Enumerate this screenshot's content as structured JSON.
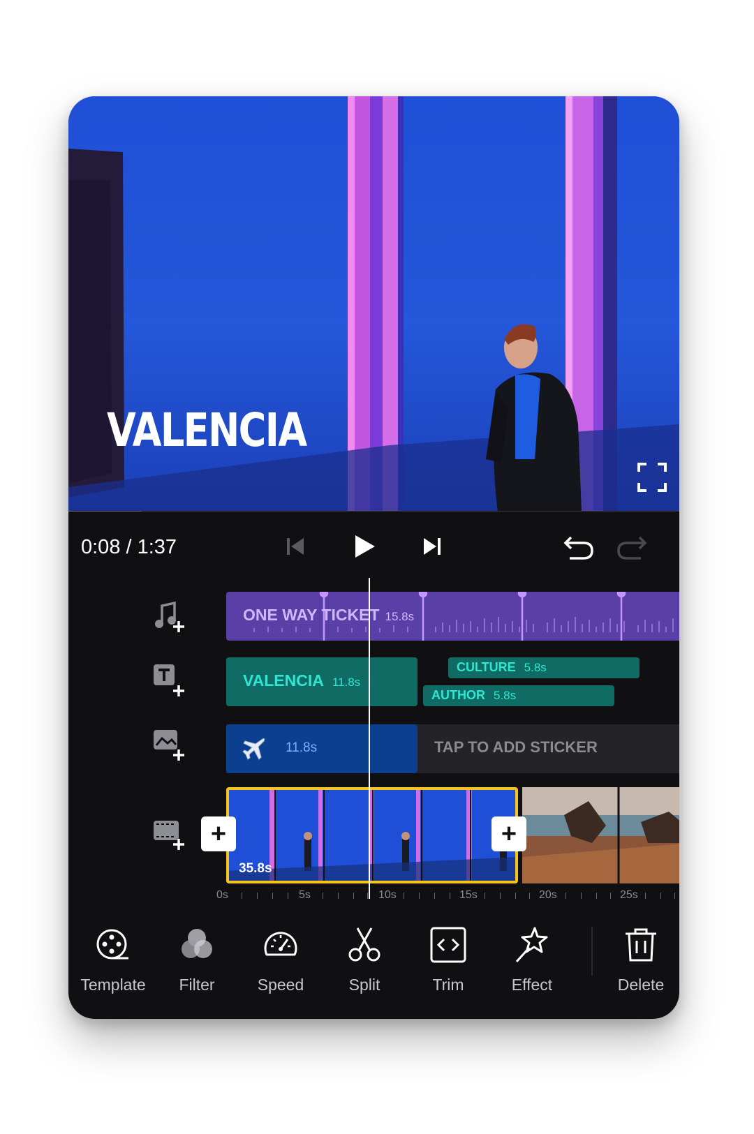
{
  "preview": {
    "title": "VALENCIA",
    "progress": 0.12
  },
  "player": {
    "time_readout": "0:08 / 1:37"
  },
  "timeline": {
    "audio_track": {
      "label": "ONE WAY TICKET",
      "duration": "15.8s"
    },
    "text_clips": [
      {
        "label": "VALENCIA",
        "duration": "11.8s"
      },
      {
        "label": "CULTURE",
        "duration": "5.8s"
      },
      {
        "label": "AUTHOR",
        "duration": "5.8s"
      }
    ],
    "sticker": {
      "icon": "airplane-icon",
      "duration": "11.8s",
      "hint": "TAP TO ADD STICKER"
    },
    "video_clip": {
      "duration": "35.8s"
    },
    "ruler": [
      "0s",
      "5s",
      "10s",
      "15s",
      "20s",
      "25s"
    ]
  },
  "toolbar": {
    "template_label": "Template",
    "filter_label": "Filter",
    "speed_label": "Speed",
    "split_label": "Split",
    "trim_label": "Trim",
    "effect_label": "Effect",
    "delete_label": "Delete"
  },
  "colors": {
    "sky_blue": "#2457da",
    "accent_yellow": "#f5c51e",
    "audio_purple": "#5a3fa6",
    "text_teal": "#0f6b63",
    "sticker_blue": "#0d3f8f"
  }
}
